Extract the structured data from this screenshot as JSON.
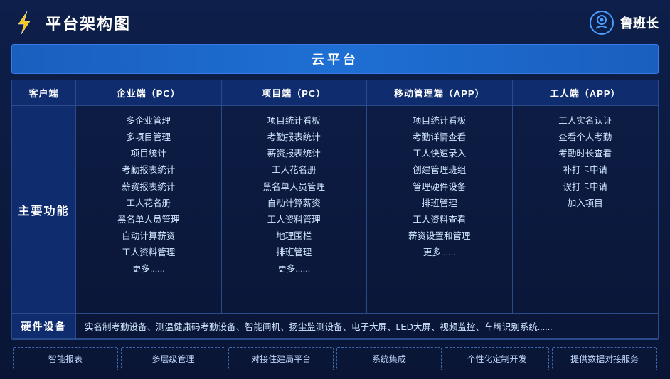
{
  "header": {
    "title": "平台架构图",
    "brand_name": "鲁班长"
  },
  "cloud_banner": "云平台",
  "col_headers": {
    "client": "客户端",
    "enterprise_pc": "企业端（PC）",
    "project_pc": "项目端（PC）",
    "mobile_app": "移动管理端（APP）",
    "worker_app": "工人端（APP）"
  },
  "main_row": {
    "label": "主要功能",
    "enterprise_features": [
      "多企业管理",
      "多项目管理",
      "项目统计",
      "考勤报表统计",
      "薪资报表统计",
      "工人花名册",
      "黑名单人员管理",
      "自动计算薪资",
      "工人资料管理",
      "更多......"
    ],
    "project_features": [
      "项目统计看板",
      "考勤报表统计",
      "薪资报表统计",
      "工人花名册",
      "黑名单人员管理",
      "自动计算薪资",
      "工人资料管理",
      "地理围栏",
      "排班管理",
      "更多......"
    ],
    "mobile_features": [
      "项目统计看板",
      "考勤详情查看",
      "工人快速录入",
      "创建管理班组",
      "管理硬件设备",
      "排班管理",
      "工人资料查看",
      "薪资设置和管理",
      "更多......"
    ],
    "worker_features": [
      "工人实名认证",
      "查看个人考勤",
      "考勤时长查看",
      "补打卡申请",
      "误打卡申请",
      "加入项目"
    ]
  },
  "hardware_row": {
    "label": "硬件设备",
    "content": "实名制考勤设备、测温健康码考勤设备、智能闸机、扬尘监测设备、电子大屏、LED大屏、视频监控、车牌识别系统......"
  },
  "features": [
    "智能报表",
    "多层级管理",
    "对接住建局平台",
    "系统集成",
    "个性化定制开发",
    "提供数据对接服务"
  ]
}
